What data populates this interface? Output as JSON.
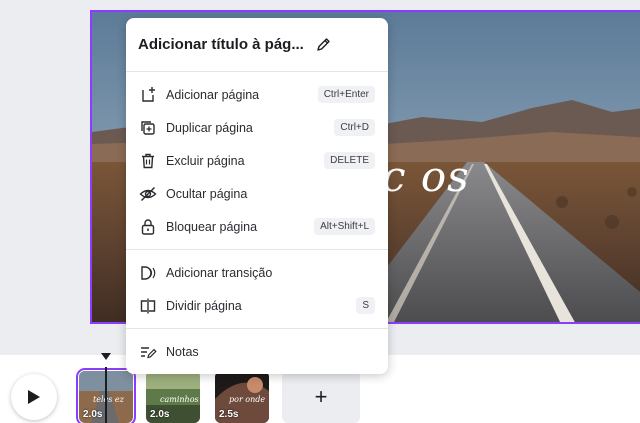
{
  "menu": {
    "title": "Adicionar título à pág...",
    "items": [
      {
        "label": "Adicionar página",
        "shortcut": "Ctrl+Enter",
        "icon": "add-page-icon"
      },
      {
        "label": "Duplicar página",
        "shortcut": "Ctrl+D",
        "icon": "duplicate-icon"
      },
      {
        "label": "Excluir página",
        "shortcut": "DELETE",
        "icon": "trash-icon"
      },
      {
        "label": "Ocultar página",
        "shortcut": "",
        "icon": "eye-off-icon"
      },
      {
        "label": "Bloquear página",
        "shortcut": "Alt+Shift+L",
        "icon": "lock-icon"
      },
      {
        "label": "Adicionar transição",
        "shortcut": "",
        "icon": "transition-icon"
      },
      {
        "label": "Dividir página",
        "shortcut": "S",
        "icon": "split-icon"
      },
      {
        "label": "Notas",
        "shortcut": "",
        "icon": "notes-icon"
      }
    ]
  },
  "canvas": {
    "script_text": "c os"
  },
  "timeline": {
    "thumbnails": [
      {
        "duration": "2.0s",
        "caption": "teles ez",
        "selected": true
      },
      {
        "duration": "2.0s",
        "caption": "caminhos",
        "selected": false
      },
      {
        "duration": "2.5s",
        "caption": "por onde",
        "selected": false
      }
    ],
    "add_label": "+"
  },
  "colors": {
    "accent": "#8b3dff",
    "background": "#ebedf1"
  }
}
